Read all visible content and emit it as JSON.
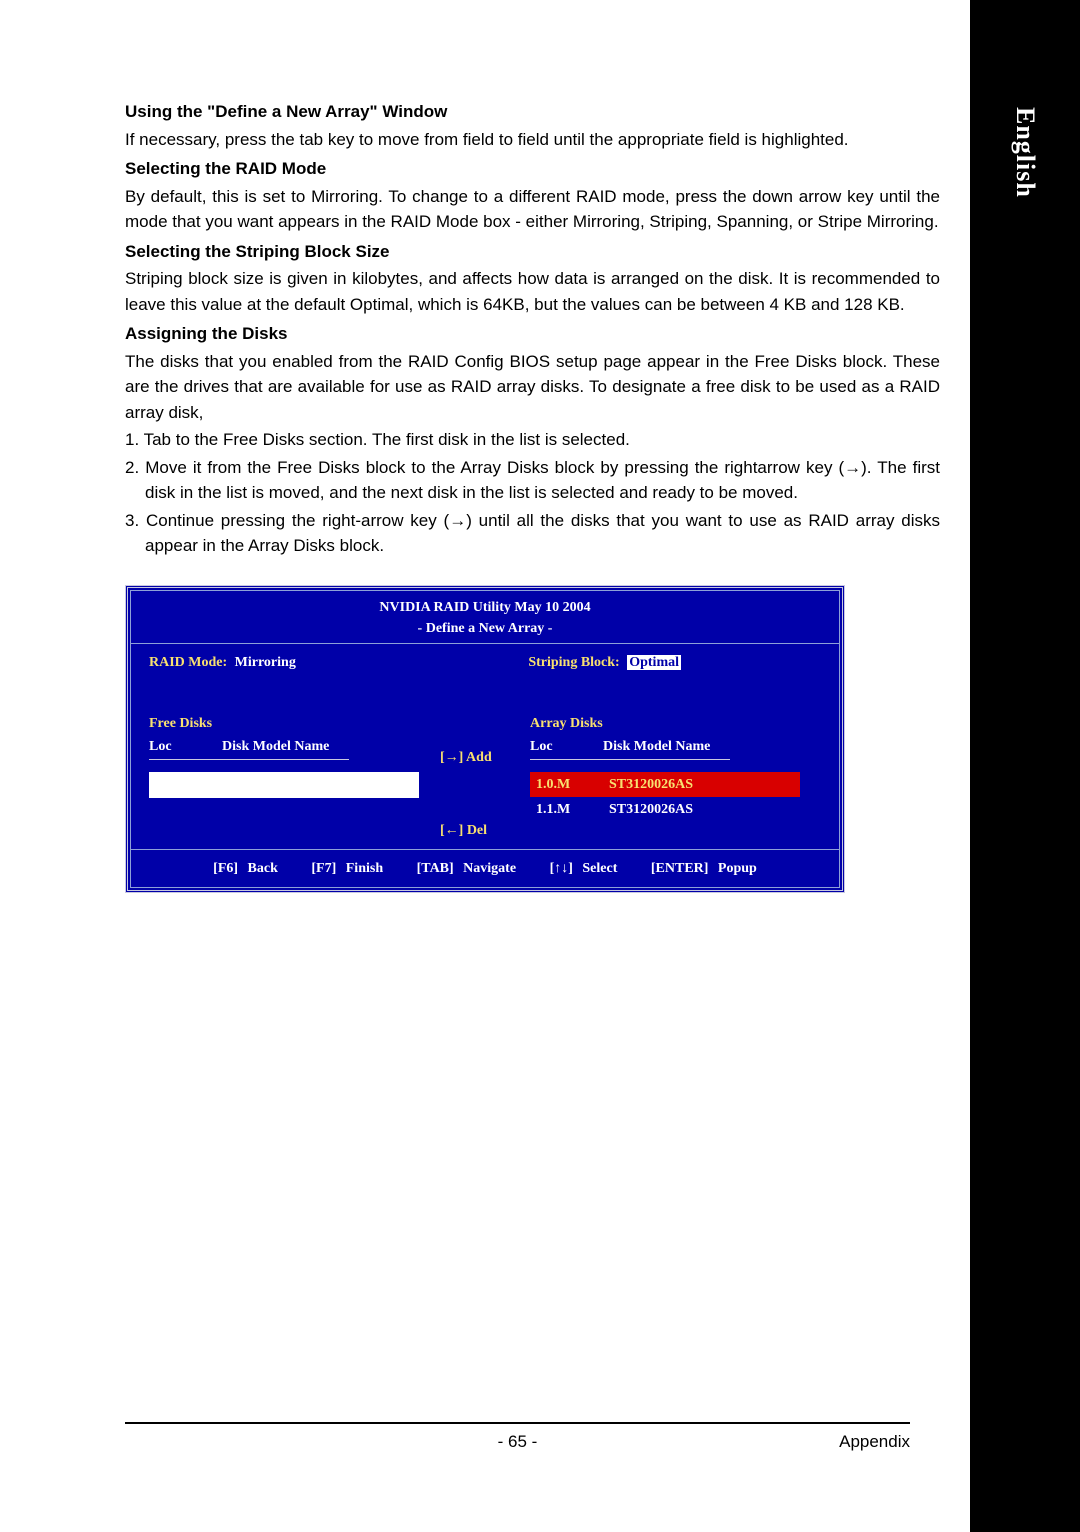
{
  "side_tab": "English",
  "sections": {
    "s1": {
      "title": "Using the \"Define a New Array\" Window",
      "body": "If necessary, press the tab key to move from field to field until the appropriate field is highlighted."
    },
    "s2": {
      "title": "Selecting the RAID Mode",
      "body": "By default, this is set to Mirroring. To change to a different RAID mode, press the down arrow key until the mode that you want appears in the RAID Mode box - either Mirroring, Striping, Spanning, or Stripe Mirroring."
    },
    "s3": {
      "title": "Selecting the Striping Block Size",
      "body": "Striping block size is given in kilobytes, and affects how data is arranged on the disk. It is recommended to leave this value at the default Optimal, which is 64KB, but the values can be between 4 KB and 128 KB."
    },
    "s4": {
      "title": "Assigning the Disks",
      "body": "The disks that you enabled from the RAID Config BIOS setup page appear in the Free Disks block. These are the drives that are available for use as RAID array disks. To designate a free disk to be used as a RAID array disk,",
      "steps": [
        "1. Tab to the Free Disks section. The first disk in the list is selected.",
        "2. Move it from the Free Disks block to the Array Disks block by pressing the rightarrow key (→). The first disk in the list is moved, and the next disk in the list is selected and ready to be moved.",
        "3. Continue pressing the right-arrow key (→) until all the disks that you want to use as RAID array disks appear in the Array Disks block."
      ]
    }
  },
  "bios": {
    "title1": "NVIDIA RAID Utility   May 10 2004",
    "title2": "- Define a New Array -",
    "raid_mode_label": "RAID Mode:",
    "raid_mode_value": "Mirroring",
    "striping_label": "Striping Block:",
    "striping_value": "Optimal",
    "free_title": "Free Disks",
    "array_title": "Array Disks",
    "col_loc": "Loc",
    "col_model": "Disk Model Name",
    "add_label": "[→] Add",
    "del_label": "[←] Del",
    "array_disks": [
      {
        "loc": "1.0.M",
        "model": "ST3120026AS",
        "selected": true
      },
      {
        "loc": "1.1.M",
        "model": "ST3120026AS",
        "selected": false
      }
    ],
    "footer": {
      "f6": "[F6] Back",
      "f7": "[F7] Finish",
      "tab": "[TAB] Navigate",
      "sel": "[↑↓] Select",
      "enter": "[ENTER] Popup"
    }
  },
  "footer": {
    "page": "- 65 -",
    "section": "Appendix"
  }
}
